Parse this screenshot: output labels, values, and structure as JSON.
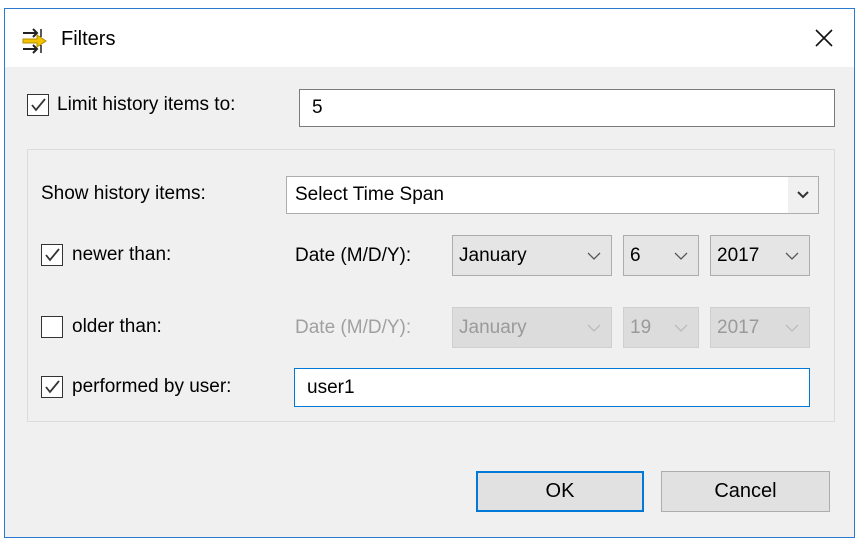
{
  "window": {
    "title": "Filters",
    "icon": "filters-icon",
    "close": "close-icon"
  },
  "limit": {
    "checked": true,
    "label": "Limit history items to:",
    "value": "5"
  },
  "show": {
    "label": "Show history items:",
    "value": "Select Time Span"
  },
  "newer": {
    "checked": true,
    "label": "newer than:",
    "date_label": "Date (M/D/Y):",
    "month": "January",
    "day": "6",
    "year": "2017"
  },
  "older": {
    "checked": false,
    "label": "older than:",
    "date_label": "Date (M/D/Y):",
    "month": "January",
    "day": "19",
    "year": "2017"
  },
  "user": {
    "checked": true,
    "label": "performed by user:",
    "value": "user1"
  },
  "buttons": {
    "ok": "OK",
    "cancel": "Cancel"
  },
  "colors": {
    "accent": "#0078d7",
    "border": "#2b79d0"
  }
}
